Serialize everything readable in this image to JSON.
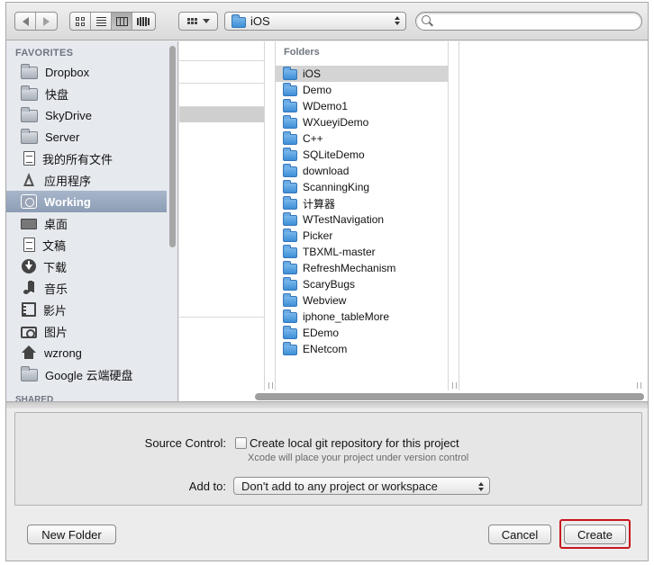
{
  "toolbar": {
    "path_label": "iOS",
    "search_placeholder": ""
  },
  "sidebar": {
    "favorites_header": "FAVORITES",
    "shared_header": "SHARED",
    "items": [
      {
        "label": "Dropbox",
        "icon": "folder-icon"
      },
      {
        "label": "快盘",
        "icon": "folder-icon"
      },
      {
        "label": "SkyDrive",
        "icon": "folder-icon"
      },
      {
        "label": "Server",
        "icon": "folder-icon"
      },
      {
        "label": "我的所有文件",
        "icon": "all-files-icon"
      },
      {
        "label": "应用程序",
        "icon": "applications-icon"
      },
      {
        "label": "Working",
        "icon": "drive-icon",
        "selected": true
      },
      {
        "label": "桌面",
        "icon": "desktop-icon"
      },
      {
        "label": "文稿",
        "icon": "documents-icon"
      },
      {
        "label": "下载",
        "icon": "downloads-icon"
      },
      {
        "label": "音乐",
        "icon": "music-icon"
      },
      {
        "label": "影片",
        "icon": "movies-icon"
      },
      {
        "label": "图片",
        "icon": "pictures-icon"
      },
      {
        "label": "wzrong",
        "icon": "home-icon"
      },
      {
        "label": "Google 云端硬盘",
        "icon": "folder-icon"
      }
    ]
  },
  "browser": {
    "folders_header": "Folders",
    "folders": [
      {
        "label": "iOS",
        "selected": true
      },
      {
        "label": "Demo"
      },
      {
        "label": "WDemo1"
      },
      {
        "label": "WXueyiDemo"
      },
      {
        "label": "C++"
      },
      {
        "label": "SQLiteDemo"
      },
      {
        "label": "download"
      },
      {
        "label": "ScanningKing"
      },
      {
        "label": "计算器"
      },
      {
        "label": "WTestNavigation"
      },
      {
        "label": "Picker"
      },
      {
        "label": "TBXML-master"
      },
      {
        "label": "RefreshMechanism"
      },
      {
        "label": "ScaryBugs"
      },
      {
        "label": "Webview"
      },
      {
        "label": "iphone_tableMore"
      },
      {
        "label": "EDemo"
      },
      {
        "label": "ENetcom"
      }
    ]
  },
  "options": {
    "source_control_label": "Source Control:",
    "git_checkbox_label": "Create local git repository for this project",
    "git_checked": false,
    "git_hint": "Xcode will place your project under version control",
    "add_to_label": "Add to:",
    "add_to_value": "Don't add to any project or workspace"
  },
  "buttons": {
    "new_folder": "New Folder",
    "cancel": "Cancel",
    "create": "Create"
  },
  "colors": {
    "selection_sidebar": "#8c9db6",
    "folder_blue": "#3d8fd8",
    "highlight_ring": "#c8161d"
  }
}
